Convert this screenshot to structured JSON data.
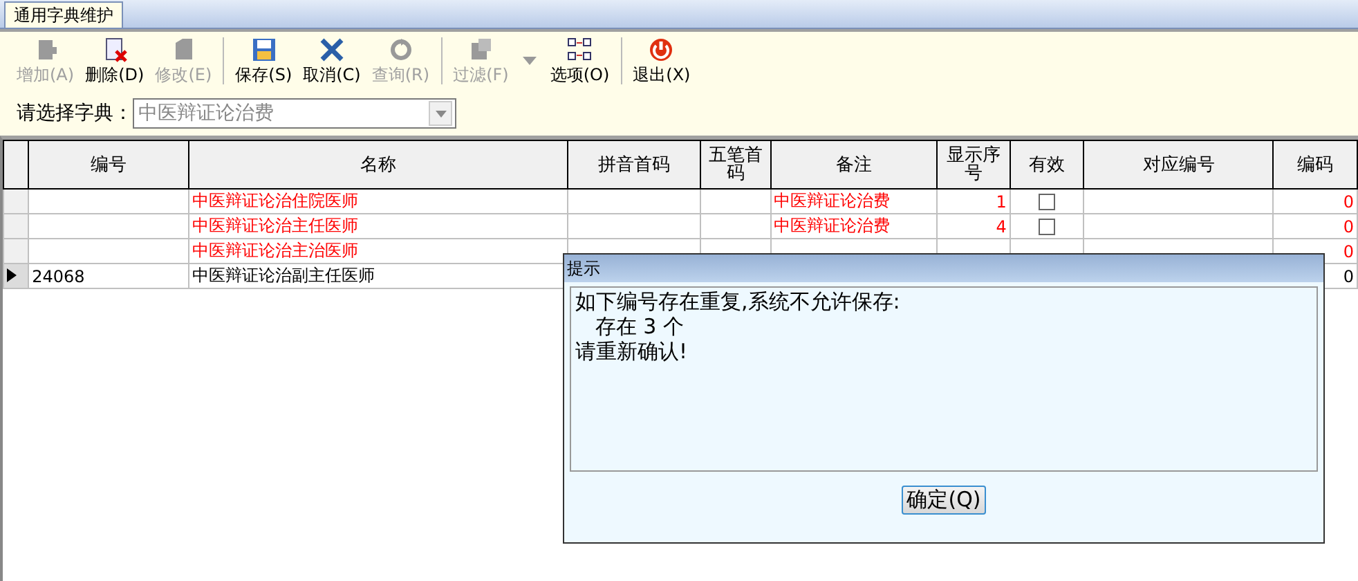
{
  "tab": {
    "label": "通用字典维护",
    "selected": true
  },
  "toolbar": [
    {
      "kind": "add",
      "label": "增加(A)",
      "disabled": true
    },
    {
      "kind": "delete",
      "label": "删除(D)",
      "disabled": false
    },
    {
      "kind": "edit",
      "label": "修改(E)",
      "disabled": true
    },
    {
      "kind": "separator"
    },
    {
      "kind": "save",
      "label": "保存(S)",
      "disabled": false
    },
    {
      "kind": "cancel",
      "label": "取消(C)",
      "disabled": false
    },
    {
      "kind": "query",
      "label": "查询(R)",
      "disabled": true
    },
    {
      "kind": "separator"
    },
    {
      "kind": "filter",
      "label": "过滤(F)",
      "disabled": true
    },
    {
      "kind": "dropdown"
    },
    {
      "kind": "options",
      "label": "选项(O)",
      "disabled": false
    },
    {
      "kind": "separator"
    },
    {
      "kind": "exit",
      "label": "退出(X)",
      "disabled": false
    }
  ],
  "dictionary": {
    "label": "请选择字典：",
    "value": "中医辩证论治费"
  },
  "table": {
    "columns": [
      "编号",
      "名称",
      "拼音首码",
      "五笔首码",
      "备注",
      "显示序号",
      "有效",
      "对应编号",
      "编码"
    ],
    "rows": [
      {
        "selected": false,
        "duplicate": true,
        "id": "",
        "name": "中医辩证论治住院医师",
        "remark": "中医辩证论治费",
        "order": "1",
        "valid": false,
        "code": "0"
      },
      {
        "selected": false,
        "duplicate": true,
        "id": "",
        "name": "中医辩证论治主任医师",
        "remark": "中医辩证论治费",
        "order": "4",
        "valid": false,
        "code": "0"
      },
      {
        "selected": false,
        "duplicate": true,
        "id": "",
        "name": "中医辩证论治主治医师",
        "code": "0"
      },
      {
        "selected": true,
        "duplicate": false,
        "id": "24068",
        "name": "中医辩证论治副主任医师",
        "code": "0"
      }
    ]
  },
  "dialog": {
    "title": "提示",
    "lines": [
      "如下编号存在重复,系统不允许保存:",
      "   存在 3 个",
      "请重新确认!"
    ],
    "button": "确定(Q)"
  }
}
